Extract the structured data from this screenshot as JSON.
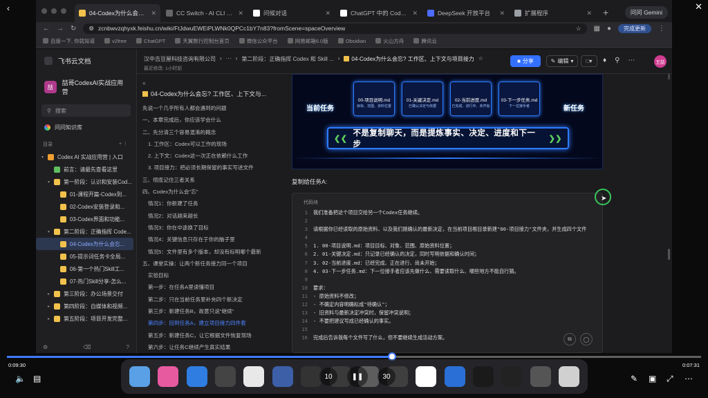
{
  "browser": {
    "tabs": [
      {
        "label": "04-Codex为什么会忘? 工作",
        "color": "#f0c14b",
        "active": true
      },
      {
        "label": "CC Switch - AI CLI 配置管理",
        "color": "#666666",
        "active": false
      },
      {
        "label": "问候对话",
        "color": "#ffffff",
        "active": false
      },
      {
        "label": "ChatGPT 中的 Codex | 专为",
        "color": "#ffffff",
        "active": false
      },
      {
        "label": "DeepSeek 开放平台",
        "color": "#4d6bfe",
        "active": false
      },
      {
        "label": "扩展程序",
        "color": "#9aa0a6",
        "active": false
      }
    ],
    "new_tab": "+",
    "gemini": "问问 Gemini",
    "url": "zcnbwvzqhyxk.feishu.cn/wiki/FtJdwuEWEiPLWNk0QPCc1bY7n83?fromScene=spaceOverview",
    "update_btn": "完成更新",
    "bookmarks": [
      "百度一下, 你就知道",
      "v2free",
      "ChatGPT",
      "天翼数行控制台首页",
      "微信公众平台",
      "网易邮箱6.0版",
      "Obsidian",
      "火山方舟",
      "腾讯云"
    ]
  },
  "sidebar": {
    "brand": "飞书云文档",
    "space_avatar": "喆",
    "space_name": "喆哥CodexAI实战应用营",
    "search": "搜索",
    "qa": "问问知识库",
    "dir_label": "目录",
    "dir_actions": "+ ⋮",
    "tree": [
      {
        "label": "Codex AI 实战应用营 | 入口",
        "level": 0,
        "arrow": "▾",
        "color": "#f0a030",
        "selected": false
      },
      {
        "label": "前言：请最先查看这里",
        "level": 1,
        "arrow": "",
        "color": "#5fbf5f",
        "selected": false
      },
      {
        "label": "第一阶段：认识和安装Cod...",
        "level": 1,
        "arrow": "▾",
        "color": "#f0c14b",
        "selected": false
      },
      {
        "label": "01-课程开篇-Codex到...",
        "level": 2,
        "arrow": "",
        "color": "#f0c14b",
        "selected": false
      },
      {
        "label": "02-Codex安装登录和...",
        "level": 2,
        "arrow": "",
        "color": "#f0c14b",
        "selected": false
      },
      {
        "label": "03-Codex界面和功能...",
        "level": 2,
        "arrow": "",
        "color": "#f0c14b",
        "selected": false
      },
      {
        "label": "第二阶段：正确指挥 Code...",
        "level": 1,
        "arrow": "▾",
        "color": "#f0c14b",
        "selected": false
      },
      {
        "label": "04-Codex为什么会忘...",
        "level": 2,
        "arrow": "",
        "color": "#f0c14b",
        "selected": true
      },
      {
        "label": "05-提示词任务卡全局...",
        "level": 2,
        "arrow": "",
        "color": "#f0c14b",
        "selected": false
      },
      {
        "label": "06-第一个热门Skill工...",
        "level": 2,
        "arrow": "",
        "color": "#f0c14b",
        "selected": false
      },
      {
        "label": "07-热门Skill分享-怎么...",
        "level": 2,
        "arrow": "",
        "color": "#f0c14b",
        "selected": false
      },
      {
        "label": "第三阶段：办公场景交付",
        "level": 1,
        "arrow": "▸",
        "color": "#f0c14b",
        "selected": false
      },
      {
        "label": "第四阶段：自媒体和视频...",
        "level": 1,
        "arrow": "▸",
        "color": "#f0c14b",
        "selected": false
      },
      {
        "label": "第五阶段：项目开发完整...",
        "level": 1,
        "arrow": "▸",
        "color": "#f0c14b",
        "selected": false
      }
    ]
  },
  "header": {
    "crumbs": [
      "汉中吉豆屋科技咨询有限公司",
      "›",
      "···",
      "›",
      "第二阶段：正确指挥 Codex 和 Skill ...",
      "›"
    ],
    "current": "04-Codex为什么会忘? 工作区、上下文与项目接力",
    "updated": "最近修改: 1小时前",
    "share": "分享",
    "edit": "编辑",
    "user": "王喆"
  },
  "outline": {
    "collapse": "«",
    "title": "04-Codex为什么会忘? 工作区、上下文与...",
    "items": [
      {
        "label": "先说一个几乎所有人都会遇到的问题",
        "level": 1,
        "active": false
      },
      {
        "label": "一、本章完成后，你应该学会什么",
        "level": 1,
        "active": false
      },
      {
        "label": "二、先分清三个容易混淆的概念",
        "level": 1,
        "active": false
      },
      {
        "label": "1. 工作区：Codex可以工作的现场",
        "level": 2,
        "active": false
      },
      {
        "label": "2. 上下文：Codex这一次正在依赖什么工作",
        "level": 2,
        "active": false
      },
      {
        "label": "3. 项目接力：把必须长期保留的事实写进文件",
        "level": 2,
        "active": false
      },
      {
        "label": "三、彻底记住三者关系",
        "level": 1,
        "active": false
      },
      {
        "label": "四、Codex为什么会\"忘\"",
        "level": 1,
        "active": false
      },
      {
        "label": "情况1：你新建了任务",
        "level": 2,
        "active": false
      },
      {
        "label": "情况2：对话越来越长",
        "level": 2,
        "active": false
      },
      {
        "label": "情况3：你在中途换了目标",
        "level": 2,
        "active": false
      },
      {
        "label": "情况4：关键信息只存在于你的脑子里",
        "level": 2,
        "active": false
      },
      {
        "label": "情况5：文件里有多个版本，却没有标明哪个最新",
        "level": 2,
        "active": false
      },
      {
        "label": "五、课堂实操：让两个新任务接力同一个项目",
        "level": 1,
        "active": false
      },
      {
        "label": "实验目标",
        "level": 2,
        "active": false
      },
      {
        "label": "第一步：在任务A里读懂项目",
        "level": 2,
        "active": false
      },
      {
        "label": "第二步：只在当前任务里补充四个新决定",
        "level": 2,
        "active": false
      },
      {
        "label": "第三步：新建任务B，故意只说\"继续\"",
        "level": 2,
        "active": false
      },
      {
        "label": "第四步：回到任务A，建立项目接力四件套",
        "level": 2,
        "active": true
      },
      {
        "label": "第五步：新建任务C，让它根据文件恢复现场",
        "level": 2,
        "active": false
      },
      {
        "label": "第六步：让任务C继续产生真实结果",
        "level": 2,
        "active": false
      },
      {
        "label": "第七步：任务结束前更新接力文件",
        "level": 2,
        "active": false
      }
    ]
  },
  "hero": {
    "left_task": "当前任务",
    "right_task": "新任务",
    "cards": [
      {
        "title": "00-项目说明.md",
        "sub": "目标、范围、资料位置"
      },
      {
        "title": "01-关键决定.md",
        "sub": "已确认决定与依据"
      },
      {
        "title": "02-当前进度.md",
        "sub": "已完成、进行中、未开始"
      },
      {
        "title": "03-下一步任务.md",
        "sub": "下一位接手者"
      }
    ],
    "banner": "不是复制聊天，而是提炼事实、决定、进度和下一步"
  },
  "doc": {
    "copy_label": "复制给任务A:",
    "code_title": "代码块",
    "code_lines": [
      {
        "n": "1",
        "t": "我们准备把这个项目交给另一个Codex任务继续。"
      },
      {
        "n": "2",
        "t": ""
      },
      {
        "n": "3",
        "t": "请根据你已经读取的原始资料、以及我们刚确认的最新决定，在当前项目根目录新建\"00-项目接力\"文件夹，并生成四个文件"
      },
      {
        "n": "4",
        "t": ""
      },
      {
        "n": "5",
        "t": "1. 00-项目说明.md：项目目标、对象、范围、原始资料位置；"
      },
      {
        "n": "6",
        "t": "2. 01-关键决定.md：只记录已经确认的决定，同时写明依据和确认时间；"
      },
      {
        "n": "7",
        "t": "3. 02-当前进度.md：已经完成、正在进行、尚未开始；"
      },
      {
        "n": "8",
        "t": "4. 03-下一步任务.md：下一位接手者应该先做什么、需要读取什么、哪些地方不能自行猜。"
      },
      {
        "n": "9",
        "t": ""
      },
      {
        "n": "10",
        "t": "要求："
      },
      {
        "n": "11",
        "t": "- 原始资料不修改；"
      },
      {
        "n": "12",
        "t": "- 不确定内容明确标成\"待确认\"；"
      },
      {
        "n": "13",
        "t": "- 旧资料与最新决定冲突时，保留冲突说明；"
      },
      {
        "n": "14",
        "t": "- 不要把建议写成已经确认的事实。"
      },
      {
        "n": "15",
        "t": ""
      },
      {
        "n": "16",
        "t": "完成后告诉我每个文件写了什么，但不要继续生成活动方案。"
      }
    ]
  },
  "player": {
    "time_current": "0:09:30",
    "time_total": "0:07:31",
    "progress": 0.555,
    "rewind": "10",
    "forward": "30"
  },
  "dock_colors": [
    "#5aa0e6",
    "#e85aa0",
    "#2f7de1",
    "#444444",
    "#e8e8e8",
    "#3c5fa8",
    "#333333",
    "#3a3a3a",
    "#5d5d5d",
    "#3f3f3f",
    "#ffffff",
    "#2a6fd6",
    "#1a1a1a",
    "#222222",
    "#555555",
    "#d0d0d0"
  ]
}
